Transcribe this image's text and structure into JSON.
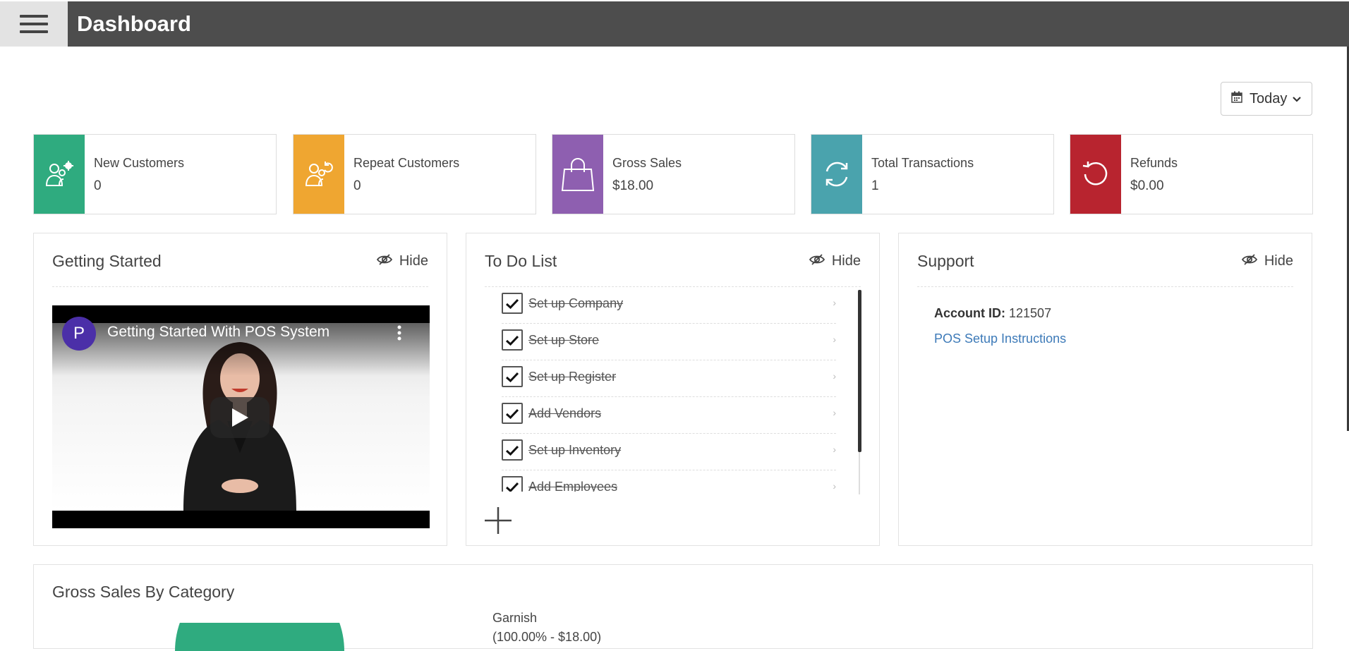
{
  "header": {
    "title": "Dashboard"
  },
  "date_filter": {
    "label": "Today"
  },
  "stats": [
    {
      "label": "New Customers",
      "value": "0",
      "color": "#2fab7f",
      "icon": "users-gear-icon"
    },
    {
      "label": "Repeat Customers",
      "value": "0",
      "color": "#efa631",
      "icon": "users-repeat-icon"
    },
    {
      "label": "Gross Sales",
      "value": "$18.00",
      "color": "#8e5fb0",
      "icon": "shopping-bag-icon"
    },
    {
      "label": "Total Transactions",
      "value": "1",
      "color": "#4aa3ad",
      "icon": "sync-icon"
    },
    {
      "label": "Refunds",
      "value": "$0.00",
      "color": "#b8242f",
      "icon": "refund-icon"
    }
  ],
  "getting_started": {
    "title": "Getting Started",
    "hide_label": "Hide",
    "video": {
      "channel_initial": "P",
      "title": "Getting Started With POS System"
    }
  },
  "todo": {
    "title": "To Do List",
    "hide_label": "Hide",
    "items": [
      {
        "label": "Set up Company",
        "done": true
      },
      {
        "label": "Set up Store",
        "done": true
      },
      {
        "label": "Set up Register",
        "done": true
      },
      {
        "label": "Add Vendors",
        "done": true
      },
      {
        "label": "Set up Inventory",
        "done": true
      },
      {
        "label": "Add Employees",
        "done": true
      }
    ]
  },
  "support": {
    "title": "Support",
    "hide_label": "Hide",
    "account_label": "Account ID:",
    "account_id": "121507",
    "setup_link": "POS Setup Instructions"
  },
  "gross_sales_by_category": {
    "title": "Gross Sales By Category",
    "legend": [
      {
        "name": "Garnish",
        "detail": "(100.00% - $18.00)"
      }
    ]
  }
}
